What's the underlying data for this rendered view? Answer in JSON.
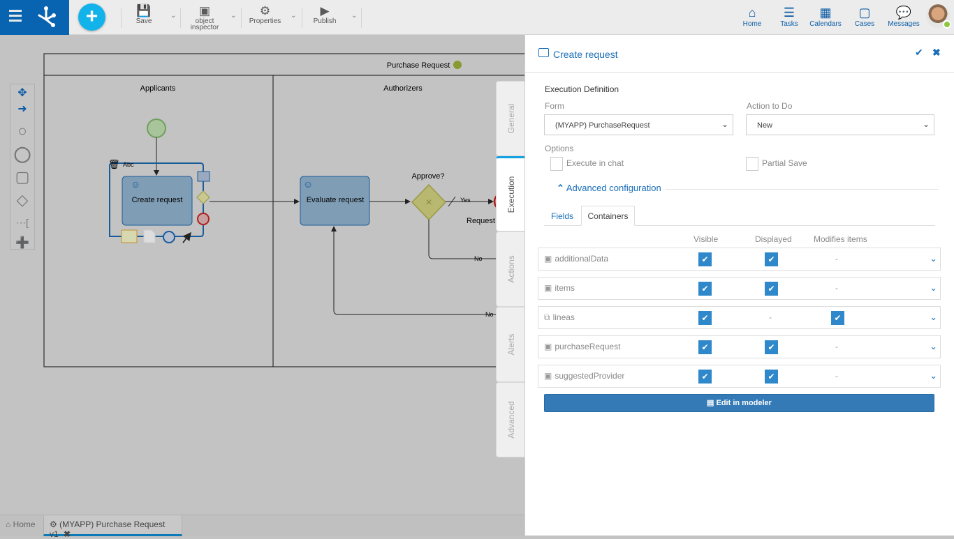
{
  "toolbar": {
    "save": "Save",
    "object_inspector": "object inspector",
    "properties": "Properties",
    "publish": "Publish"
  },
  "nav": {
    "home": "Home",
    "tasks": "Tasks",
    "calendars": "Calendars",
    "cases": "Cases",
    "messages": "Messages"
  },
  "diagram": {
    "pool": "Purchase Request",
    "lanes": [
      "Applicants",
      "Authorizers"
    ],
    "tasks": [
      "Create request",
      "Evaluate request"
    ],
    "gateway": "Approve?",
    "flows": {
      "yes": "Yes",
      "no": "No",
      "no2": "No"
    },
    "end_label": "Request",
    "text_tool": "Abc"
  },
  "side_tabs": [
    "General",
    "Execution",
    "Actions",
    "Alerts",
    "Advanced"
  ],
  "panel": {
    "title": "Create request",
    "section": "Execution Definition",
    "form_label": "Form",
    "form_value": "(MYAPP) PurchaseRequest",
    "action_label": "Action to Do",
    "action_value": "New",
    "options_label": "Options",
    "execute_in_chat": "Execute in chat",
    "partial_save": "Partial Save",
    "advanced": "Advanced configuration",
    "tabs": [
      "Fields",
      "Containers"
    ],
    "active_tab": "Containers",
    "columns": [
      "Visible",
      "Displayed",
      "Modifies items"
    ],
    "rows": [
      {
        "name": "additionalData",
        "icon": "grid-icon",
        "visible": true,
        "displayed": true,
        "modifies": "-"
      },
      {
        "name": "items",
        "icon": "grid-icon",
        "visible": true,
        "displayed": true,
        "modifies": "-"
      },
      {
        "name": "lineas",
        "icon": "copy-icon",
        "visible": true,
        "displayed": "-",
        "modifies": true
      },
      {
        "name": "purchaseRequest",
        "icon": "grid-icon",
        "visible": true,
        "displayed": true,
        "modifies": "-"
      },
      {
        "name": "suggestedProvider",
        "icon": "grid-icon",
        "visible": true,
        "displayed": true,
        "modifies": "-"
      }
    ],
    "edit_button": "Edit in modeler"
  },
  "bottom_tabs": {
    "home": "Home",
    "process": "(MYAPP) Purchase Request v1"
  },
  "colors": {
    "brand": "#0864b0",
    "accent": "#12b3eb",
    "checkbox": "#2e88c9"
  }
}
